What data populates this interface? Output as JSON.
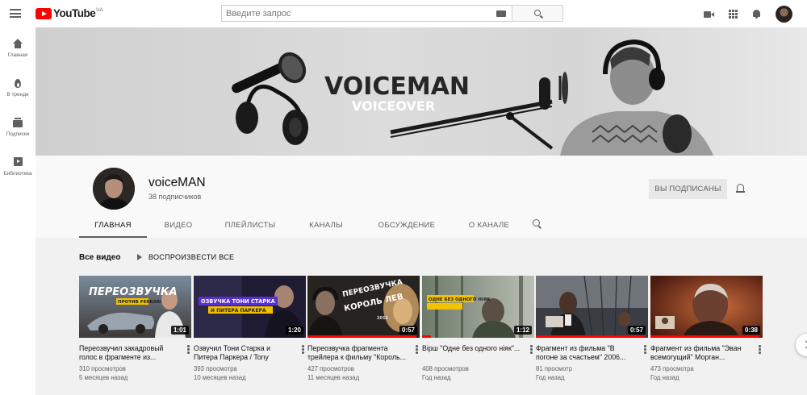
{
  "topbar": {
    "logo_text": "YouTube",
    "logo_region": "UA",
    "search_placeholder": "Введите запрос"
  },
  "sidebar": {
    "items": [
      {
        "label": "Главная",
        "icon": "home-icon"
      },
      {
        "label": "В тренде",
        "icon": "fire-icon"
      },
      {
        "label": "Подписки",
        "icon": "subscriptions-icon"
      },
      {
        "label": "Библиотека",
        "icon": "library-icon"
      }
    ]
  },
  "banner": {
    "title": "VOICEMAN",
    "subtitle": "VOICEOVER"
  },
  "channel": {
    "name": "voiceMAN",
    "subscribers": "38 подписчиков",
    "subscribe_label": "ВЫ ПОДПИСАНЫ"
  },
  "tabs": [
    "ГЛАВНАЯ",
    "ВИДЕО",
    "ПЛЕЙЛИСТЫ",
    "КАНАЛЫ",
    "ОБСУЖДЕНИЕ",
    "О КАНАЛЕ"
  ],
  "section": {
    "title": "Все видео",
    "play_all_label": "ВОСПРОИЗВЕСТИ ВСЕ"
  },
  "videos": [
    {
      "title": "Переозвучил закадровый голос в фрагменте из...",
      "views": "310 просмотров",
      "age": "5 месяцев назад",
      "duration": "1:01",
      "thumb_text": "ПЕРЕОЗВУЧКА",
      "thumb_sub": "ПРОТИВ FERRARI",
      "watched": 0
    },
    {
      "title": "Озвучил Тони Старка и Питера Паркера / Tony Stark...",
      "views": "393 просмотра",
      "age": "10 месяцев назад",
      "duration": "1:20",
      "thumb_text": "ОЗВУЧКА ТОНИ СТАРКА",
      "thumb_sub": "И ПИТЕРА ПАРКЕРА",
      "watched": 0
    },
    {
      "title": "Переозвучка фрагмента трейлера к фильму \"Король...",
      "views": "427 просмотров",
      "age": "11 месяцев назад",
      "duration": "0:57",
      "thumb_text": "ПЕРЕОЗВУЧКА",
      "thumb_sub": "КОРОЛЬ ЛЕВ",
      "thumb_year": "2019",
      "watched": 0.97
    },
    {
      "title": "Вірш \"Одне без одного ніяк\"...",
      "views": "408 просмотров",
      "age": "Год назад",
      "duration": "1:12",
      "thumb_text": "ОДНЕ БЕЗ ОДНОГО НІЯК",
      "watched": 0.08
    },
    {
      "title": "Фрагмент из фильма \"В погоне за счастьем\" 2006...",
      "views": "81 просмотр",
      "age": "Год назад",
      "duration": "0:57",
      "watched": 0.97
    },
    {
      "title": "Фрагмент из фильма \"Эван всемогущий\" Морган...",
      "views": "473 просмотра",
      "age": "Год назад",
      "duration": "0:38",
      "watched": 0.97
    }
  ],
  "colors": {
    "accent": "#ff0000",
    "text": "#0f0f0f",
    "secondary": "#606060"
  }
}
